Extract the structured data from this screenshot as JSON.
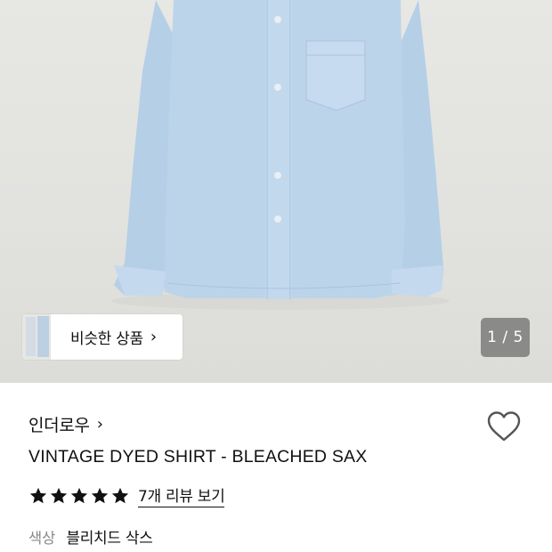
{
  "product_image": {
    "similar_button_label": "비슷한 상품",
    "counter": "1 / 5"
  },
  "product": {
    "brand": "인더로우",
    "title": "VINTAGE DYED SHIRT - BLEACHED SAX",
    "rating": 5,
    "review_link": "7개 리뷰 보기",
    "color_label": "색상",
    "color_value": "블리치드 삭스"
  },
  "colors": {
    "shirt": "#b9d2ea",
    "background": "#e4e4e1",
    "star": "#111111"
  },
  "icons": {
    "similar_chevron": "chevron-right-icon",
    "brand_chevron": "chevron-right-icon",
    "wishlist": "heart-outline-icon",
    "rating": "star-filled-icon"
  }
}
